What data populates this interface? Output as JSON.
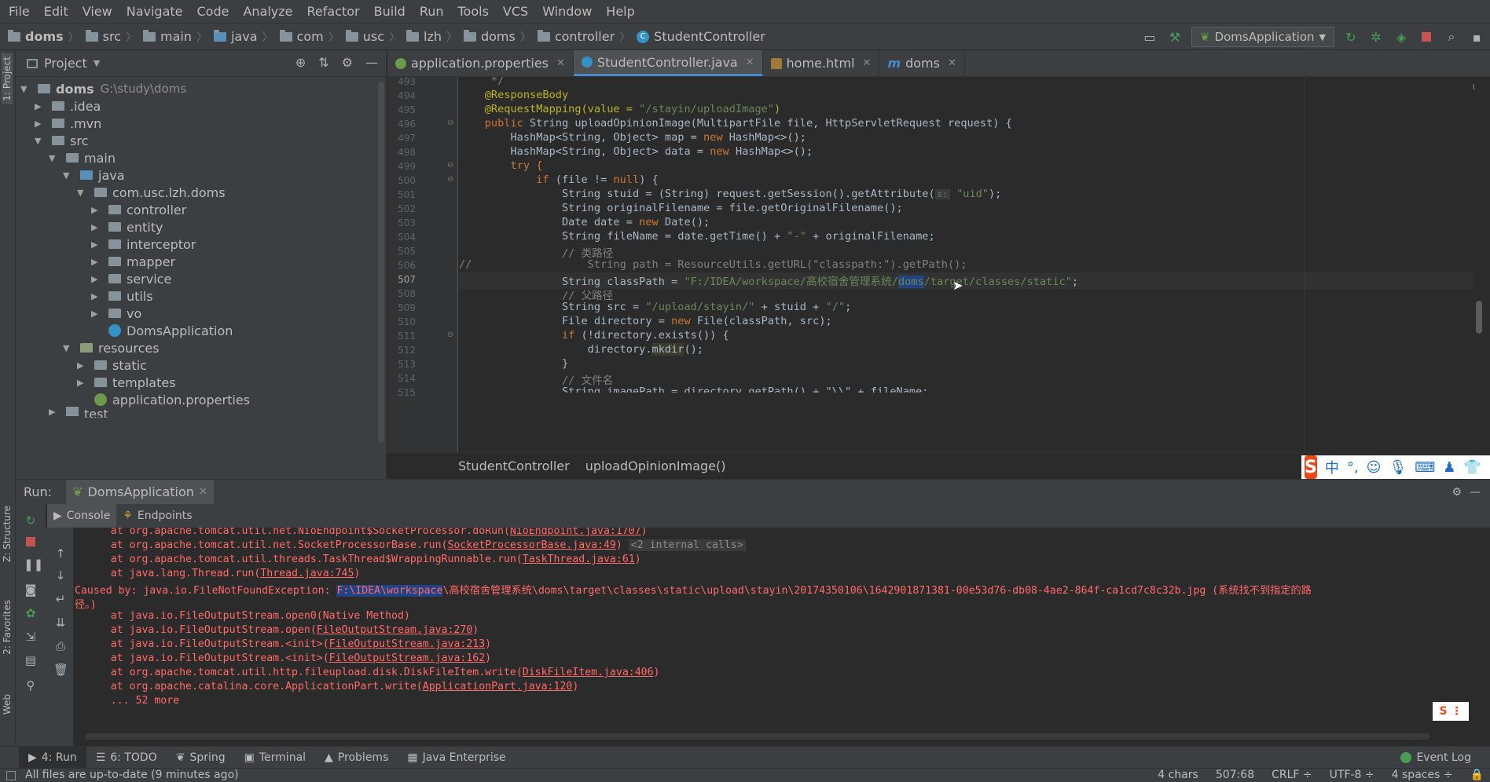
{
  "menu": [
    "File",
    "Edit",
    "View",
    "Navigate",
    "Code",
    "Analyze",
    "Refactor",
    "Build",
    "Run",
    "Tools",
    "VCS",
    "Window",
    "Help"
  ],
  "breadcrumbs": [
    "doms",
    "src",
    "main",
    "java",
    "com",
    "usc",
    "lzh",
    "doms",
    "controller",
    "StudentController"
  ],
  "run_config": "DomsApplication",
  "left_stripe": {
    "project": "1: Project",
    "structure": "Z: Structure",
    "favorites": "2: Favorites",
    "web": "Web"
  },
  "project_panel": {
    "title": "Project",
    "tree": [
      {
        "name": "doms",
        "path": "G:\\study\\doms"
      },
      {
        "name": ".idea"
      },
      {
        "name": ".mvn"
      },
      {
        "name": "src"
      },
      {
        "name": "main"
      },
      {
        "name": "java"
      },
      {
        "name": "com.usc.lzh.doms"
      },
      {
        "name": "controller"
      },
      {
        "name": "entity"
      },
      {
        "name": "interceptor"
      },
      {
        "name": "mapper"
      },
      {
        "name": "service"
      },
      {
        "name": "utils"
      },
      {
        "name": "vo"
      },
      {
        "name": "DomsApplication"
      },
      {
        "name": "resources"
      },
      {
        "name": "static"
      },
      {
        "name": "templates"
      },
      {
        "name": "application.properties"
      },
      {
        "name": "test"
      }
    ]
  },
  "editor_tabs": [
    {
      "label": "application.properties"
    },
    {
      "label": "StudentController.java"
    },
    {
      "label": "home.html"
    },
    {
      "label": "doms"
    }
  ],
  "code": {
    "line_numbers": [
      "493",
      "494",
      "495",
      "496",
      "497",
      "498",
      "499",
      "500",
      "501",
      "502",
      "503",
      "504",
      "505",
      "506",
      "507",
      "508",
      "509",
      "510",
      "511",
      "512",
      "513",
      "514",
      "515"
    ],
    "lines": {
      "l493": "     */",
      "l494": "    @ResponseBody",
      "l495a": "    @RequestMapping(value = ",
      "l495b": "\"/stayin/uploadImage\"",
      "l495c": ")",
      "l496a": "    public ",
      "l496b": "String uploadOpinionImage(MultipartFile file, HttpServletRequest request) {",
      "l497a": "        HashMap<String, Object> map = ",
      "l497b": "new ",
      "l497c": "HashMap<>();",
      "l498a": "        HashMap<String, Object> data = ",
      "l498b": "new ",
      "l498c": "HashMap<>();",
      "l499": "        try {",
      "l500a": "            if ",
      "l500b": "(file != ",
      "l500c": "null",
      "l500d": ") {",
      "l501a": "                String stuid = (String) request.getSession().getAttribute(",
      "l501hint": "s:",
      "l501b": " \"uid\"",
      "l501c": ");",
      "l502": "                String originalFilename = file.getOriginalFilename();",
      "l503a": "                Date date = ",
      "l503b": "new ",
      "l503c": "Date();",
      "l504a": "                String fileName = date.getTime() + ",
      "l504b": "\"-\"",
      "l504c": " + originalFilename;",
      "l505": "                // 类路径",
      "l506": "//                  String path = ResourceUtils.getURL(\"classpath:\").getPath();",
      "l507a": "                String classPath = ",
      "l507b": "\"F:/IDEA/workspace/高校宿舍管理系统/",
      "l507sel": "doms",
      "l507c": "/target/classes/static\"",
      "l507d": ";",
      "l508": "                // 父路径",
      "l509a": "                String src = ",
      "l509b": "\"/upload/stayin/\"",
      "l509c": " + stuid + ",
      "l509d": "\"/\"",
      "l509e": ";",
      "l510a": "                File directory = ",
      "l510b": "new ",
      "l510c": "File(classPath, src);",
      "l511a": "                if ",
      "l511b": "(!directory.exists()) {",
      "l512a": "                    directory.",
      "l512b": "mkdir",
      "l512c": "();",
      "l513": "                }",
      "l514": "                // 文件名",
      "l515": "                String imagePath = directory.getPath() + \"\\\\\" + fileName;"
    }
  },
  "editor_breadcrumb": [
    "StudentController",
    "uploadOpinionImage()"
  ],
  "ime": {
    "logo": "S",
    "lang": "中"
  },
  "run_panel": {
    "label": "Run:",
    "tab": "DomsApplication",
    "subtabs": [
      "Console",
      "Endpoints"
    ]
  },
  "console": {
    "l1a": "    at org.apache.tomcat.util.net.NioEndpoint$SocketProcessor.doRun(",
    "l1link": "NioEndpoint.java:1707",
    "l1b": ")",
    "l2a": "    at org.apache.tomcat.util.net.SocketProcessorBase.run(",
    "l2link": "SocketProcessorBase.java:49",
    "l2b": ") ",
    "l2internal": "<2 internal calls>",
    "l3a": "    at org.apache.tomcat.util.threads.TaskThread$WrappingRunnable.run(",
    "l3link": "TaskThread.java:61",
    "l3b": ")",
    "l4a": "    at java.lang.Thread.run(",
    "l4link": "Thread.java:745",
    "l4b": ")",
    "l5a": "Caused by: java.io.FileNotFoundException: ",
    "l5hl": "F:\\IDEA\\workspace",
    "l5b": "\\高校宿舍管理系统\\doms\\target\\classes\\static\\upload\\stayin\\20174350106\\1642901871381-00e53d76-db08-4ae2-864f-ca1cd7c8c32b.jpg (系统找不到指定的路",
    "l6": "径。)",
    "l7": "    at java.io.FileOutputStream.open0(Native Method)",
    "l8a": "    at java.io.FileOutputStream.open(",
    "l8link": "FileOutputStream.java:270",
    "l8b": ")",
    "l9a": "    at java.io.FileOutputStream.<init>(",
    "l9link": "FileOutputStream.java:213",
    "l9b": ")",
    "l10a": "    at java.io.FileOutputStream.<init>(",
    "l10link": "FileOutputStream.java:162",
    "l10b": ")",
    "l11a": "    at org.apache.tomcat.util.http.fileupload.disk.DiskFileItem.write(",
    "l11link": "DiskFileItem.java:406",
    "l11b": ")",
    "l12a": "    at org.apache.catalina.core.ApplicationPart.write(",
    "l12link": "ApplicationPart.java:120",
    "l12b": ")",
    "l13": "    ... 52 more"
  },
  "bottom_tabs": [
    "4: Run",
    "6: TODO",
    "Spring",
    "Terminal",
    "Problems",
    "Java Enterprise"
  ],
  "event_log": "Event Log",
  "status": {
    "message": "All files are up-to-date (9 minutes ago)",
    "chars": "4 chars",
    "position": "507:68",
    "line_sep": "CRLF ÷",
    "encoding": "UTF-8 ÷",
    "indent": "4 spaces ÷"
  }
}
